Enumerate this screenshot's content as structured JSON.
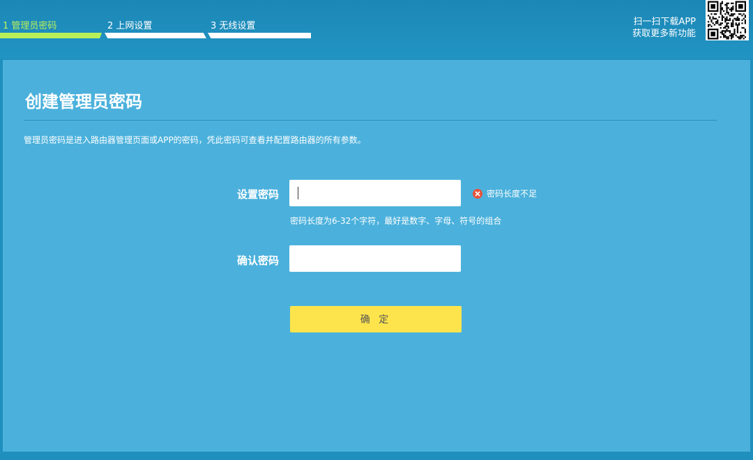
{
  "steps": [
    {
      "label": "1 管理员密码",
      "active": true
    },
    {
      "label": "2 上网设置",
      "active": false
    },
    {
      "label": "3 无线设置",
      "active": false
    }
  ],
  "app_promo": {
    "line1": "扫一扫下载APP",
    "line2": "获取更多新功能"
  },
  "qr_icon": "qr-code",
  "page": {
    "title": "创建管理员密码",
    "description": "管理员密码是进入路由器管理页面或APP的密码，凭此密码可查看并配置路由器的所有参数。"
  },
  "form": {
    "set_password": {
      "label": "设置密码",
      "value": "",
      "error": "密码长度不足",
      "hint": "密码长度为6-32个字符，最好是数字、字母、符号的组合"
    },
    "confirm_password": {
      "label": "确认密码",
      "value": ""
    },
    "submit_label": "确 定"
  },
  "colors": {
    "header_bg": "#1f8fbd",
    "panel_bg": "#4bb1dc",
    "active_step": "#b9f05a",
    "button_bg": "#fde44c",
    "error_icon": "#e8533a"
  }
}
